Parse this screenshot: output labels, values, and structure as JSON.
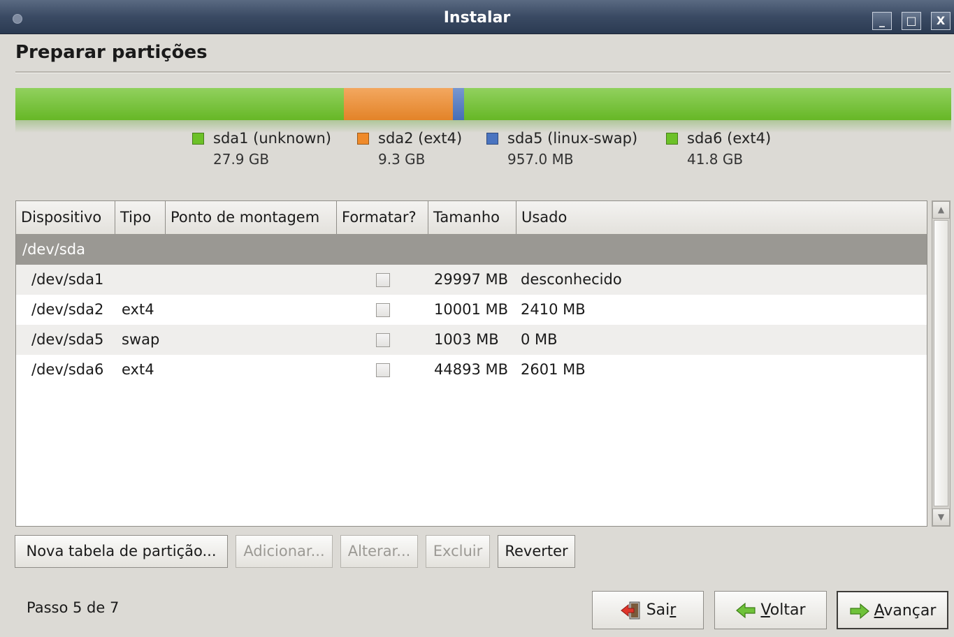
{
  "window": {
    "title": "Instalar",
    "buttons": [
      "_",
      "□",
      "X"
    ]
  },
  "page": {
    "heading": "Preparar partições"
  },
  "partition_bar": {
    "segments": [
      {
        "name": "sda1",
        "color": "#6cc128",
        "fraction": 0.3508
      },
      {
        "name": "sda2",
        "color": "#ef8a2a",
        "fraction": 0.117
      },
      {
        "name": "sda5",
        "color": "#4a74c0",
        "fraction": 0.012
      },
      {
        "name": "sda6",
        "color": "#6cc128",
        "fraction": 0.5202
      }
    ],
    "legend": [
      {
        "name": "sda1 (unknown)",
        "size": "27.9 GB",
        "color": "#6cc128"
      },
      {
        "name": "sda2 (ext4)",
        "size": "9.3 GB",
        "color": "#ef8a2a"
      },
      {
        "name": "sda5 (linux-swap)",
        "size": "957.0 MB",
        "color": "#4a74c0"
      },
      {
        "name": "sda6 (ext4)",
        "size": "41.8 GB",
        "color": "#6cc128"
      }
    ]
  },
  "table": {
    "columns": [
      "Dispositivo",
      "Tipo",
      "Ponto de montagem",
      "Formatar?",
      "Tamanho",
      "Usado"
    ],
    "group": "/dev/sda",
    "rows": [
      {
        "device": "/dev/sda1",
        "type": "",
        "mount": "",
        "format": false,
        "size": "29997 MB",
        "used": "desconhecido"
      },
      {
        "device": "/dev/sda2",
        "type": "ext4",
        "mount": "",
        "format": false,
        "size": "10001 MB",
        "used": "2410 MB"
      },
      {
        "device": "/dev/sda5",
        "type": "swap",
        "mount": "",
        "format": false,
        "size": "1003 MB",
        "used": "0 MB"
      },
      {
        "device": "/dev/sda6",
        "type": "ext4",
        "mount": "",
        "format": false,
        "size": "44893 MB",
        "used": "2601 MB"
      }
    ]
  },
  "actions": {
    "new_table": "Nova tabela de partição...",
    "add": "Adicionar...",
    "change": "Alterar...",
    "delete": "Excluir",
    "revert": "Reverter"
  },
  "footer": {
    "step": "Passo 5 de 7",
    "quit_pre": "Sai",
    "quit_u": "r",
    "back_u": "V",
    "back_post": "oltar",
    "forward_u": "A",
    "forward_post": "vançar"
  }
}
